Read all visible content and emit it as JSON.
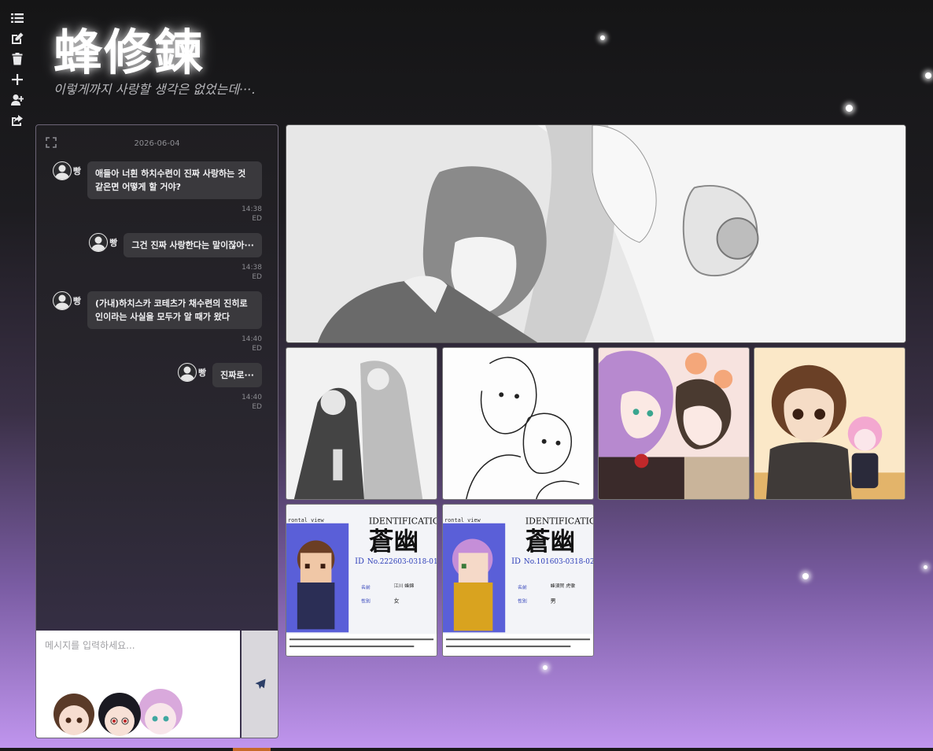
{
  "app": {
    "title": "蜂修鍊",
    "subtitle": "이렇게까지 사랑할 생각은 없었는데···."
  },
  "toolbar": {
    "items": [
      {
        "icon": "list-icon"
      },
      {
        "icon": "edit-icon"
      },
      {
        "icon": "trash-icon"
      },
      {
        "icon": "plus-icon"
      },
      {
        "icon": "user-plus-icon"
      },
      {
        "icon": "share-icon"
      }
    ]
  },
  "chat": {
    "date": "2026-06-04",
    "messages": [
      {
        "sender": "빵",
        "text": "애들아 너흰 하치수련이 진짜 사랑하는 것 같은면 어떻게 할 거야?",
        "time": "14:38",
        "status": "ED"
      },
      {
        "sender": "빵",
        "text": "그건 진짜 사랑한다는 말이잖아···",
        "time": "14:38",
        "status": "ED"
      },
      {
        "sender": "빵",
        "text": "(가내)하치스카 코테츠가 채수련의 진히로인이라는 사실을 모두가 알 때가 왔다",
        "time": "14:40",
        "status": "ED"
      },
      {
        "sender": "빵",
        "text": "진짜로···",
        "time": "14:40",
        "status": "ED"
      }
    ],
    "input_placeholder": "메시지를 입력하세요...",
    "send_icon": "paper-plane-icon"
  },
  "gallery": {
    "id_cards": [
      {
        "header": "IDENTIFICATION C",
        "brand": "蒼幽",
        "view": "rontal view",
        "id_no": "No.222603-0318-01",
        "name": "江川 蜂錦",
        "gender": "女"
      },
      {
        "header": "IDENTIFICATION C",
        "brand": "蒼幽",
        "view": "rontal view",
        "id_no": "No.101603-0318-02",
        "name": "蜂須賀 虎徹",
        "gender": "男"
      }
    ]
  },
  "colors": {
    "accent": "#2d3f68",
    "bubble": "#3a393d",
    "gradient_bottom": "#c196ef"
  }
}
